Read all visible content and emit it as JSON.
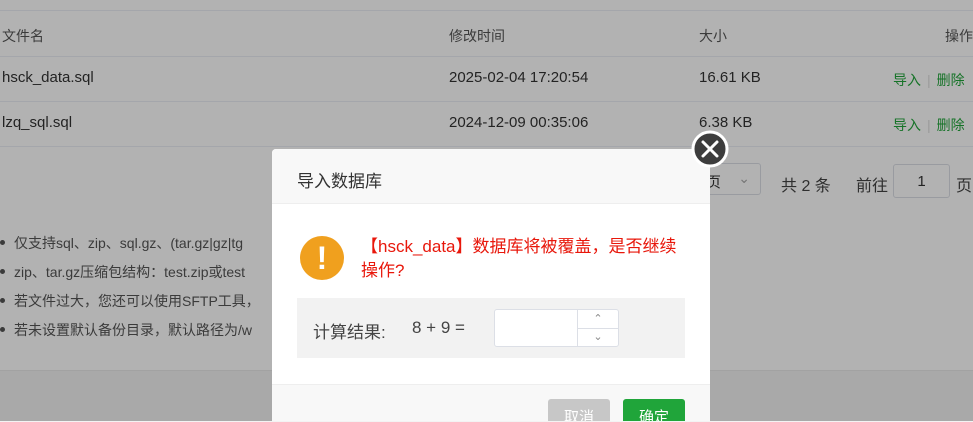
{
  "table": {
    "headers": {
      "name": "文件名",
      "time": "修改时间",
      "size": "大小",
      "ops": "操作"
    },
    "rows": [
      {
        "name": "hsck_data.sql",
        "time": "2025-02-04 17:20:54",
        "size": "16.61 KB",
        "import": "导入",
        "delete": "删除"
      },
      {
        "name": "lzq_sql.sql",
        "time": "2024-12-09 00:35:06",
        "size": "6.38 KB",
        "import": "导入",
        "delete": "删除"
      }
    ]
  },
  "pagination": {
    "per_page_text": "页",
    "total_text": "共 2 条",
    "goto_label": "前往",
    "goto_value": "1",
    "page_suffix": "页"
  },
  "tips": [
    "仅支持sql、zip、sql.gz、(tar.gz|gz|tg",
    "zip、tar.gz压缩包结构：test.zip或test",
    "若文件过大，您还可以使用SFTP工具，",
    "若未设置默认备份目录，默认路径为/w"
  ],
  "dialog": {
    "title": "导入数据库",
    "warning": "【hsck_data】数据库将被覆盖，是否继续操作?",
    "calc_label": "计算结果:",
    "calc_expression": "8 + 9  =",
    "calc_value": "",
    "cancel_label": "取消",
    "confirm_label": "确定"
  },
  "colors": {
    "accent": "#20a53a",
    "warning_text": "#e8170b",
    "warning_icon": "#f0a01e"
  }
}
